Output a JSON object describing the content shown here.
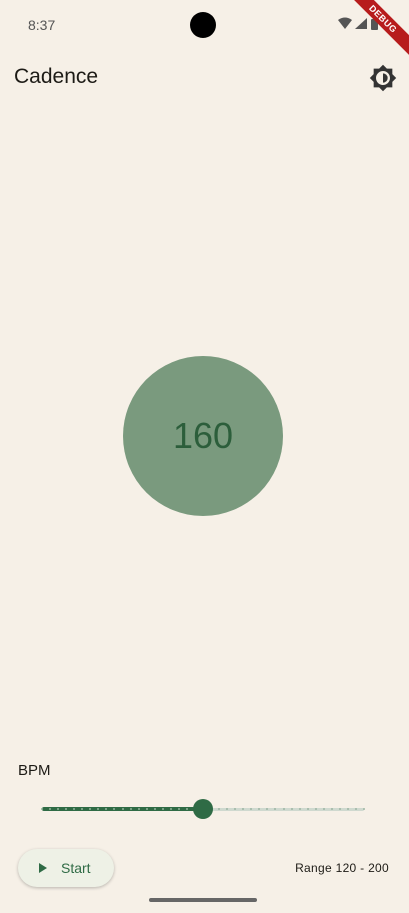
{
  "status_bar": {
    "time": "8:37",
    "debug_label": "DEBUG",
    "icons": [
      "wifi-icon",
      "signal-icon",
      "battery-icon"
    ]
  },
  "app_bar": {
    "title": "Cadence",
    "theme_icon": "brightness-icon"
  },
  "display": {
    "bpm": "160"
  },
  "slider": {
    "label": "BPM",
    "min": 120,
    "max": 200,
    "value": 160,
    "divisions": 40
  },
  "controls": {
    "start_label": "Start",
    "start_icon": "play-icon",
    "range_text": "Range 120 - 200"
  },
  "colors": {
    "background": "#f6f0e7",
    "accent": "#2f6b45",
    "circle": "#7a9a7e"
  }
}
